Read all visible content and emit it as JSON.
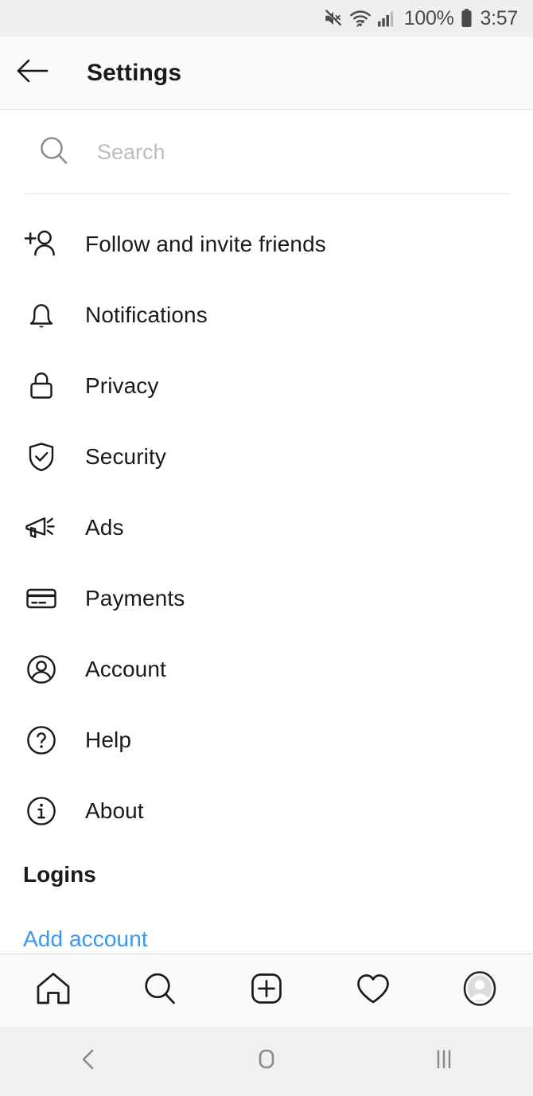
{
  "status_bar": {
    "icons": [
      "mute-icon",
      "wifi-icon",
      "cellular-signal-icon"
    ],
    "battery_percent": "100%",
    "battery_icon": "battery-full-icon",
    "clock": "3:57",
    "background": "#efefef",
    "text_color": "#4a4a4a"
  },
  "header": {
    "back_icon": "back-arrow-icon",
    "title": "Settings",
    "background": "#fafafa"
  },
  "search": {
    "icon": "search-icon",
    "placeholder": "Search",
    "value": ""
  },
  "settings_list": [
    {
      "label": "Follow and invite friends",
      "icon": "add-person-icon"
    },
    {
      "label": "Notifications",
      "icon": "bell-icon"
    },
    {
      "label": "Privacy",
      "icon": "lock-icon"
    },
    {
      "label": "Security",
      "icon": "shield-check-icon"
    },
    {
      "label": "Ads",
      "icon": "megaphone-icon"
    },
    {
      "label": "Payments",
      "icon": "credit-card-icon"
    },
    {
      "label": "Account",
      "icon": "account-circle-icon"
    },
    {
      "label": "Help",
      "icon": "question-circle-icon"
    },
    {
      "label": "About",
      "icon": "info-circle-icon"
    }
  ],
  "logins": {
    "heading": "Logins",
    "add_account_label": "Add account",
    "link_color": "#3897f0"
  },
  "tab_bar": {
    "tabs": [
      {
        "name": "home",
        "icon": "home-icon"
      },
      {
        "name": "search",
        "icon": "search-icon"
      },
      {
        "name": "create",
        "icon": "plus-square-icon"
      },
      {
        "name": "activity",
        "icon": "heart-icon"
      },
      {
        "name": "profile",
        "icon": "profile-avatar-icon"
      }
    ],
    "background": "#fafafa"
  },
  "system_nav": {
    "buttons": [
      {
        "name": "back",
        "icon": "chevron-left-icon"
      },
      {
        "name": "home",
        "icon": "rounded-square-icon"
      },
      {
        "name": "recents",
        "icon": "three-bars-icon"
      }
    ],
    "background": "#f0f0f0",
    "icon_color": "#8a8a8a"
  }
}
